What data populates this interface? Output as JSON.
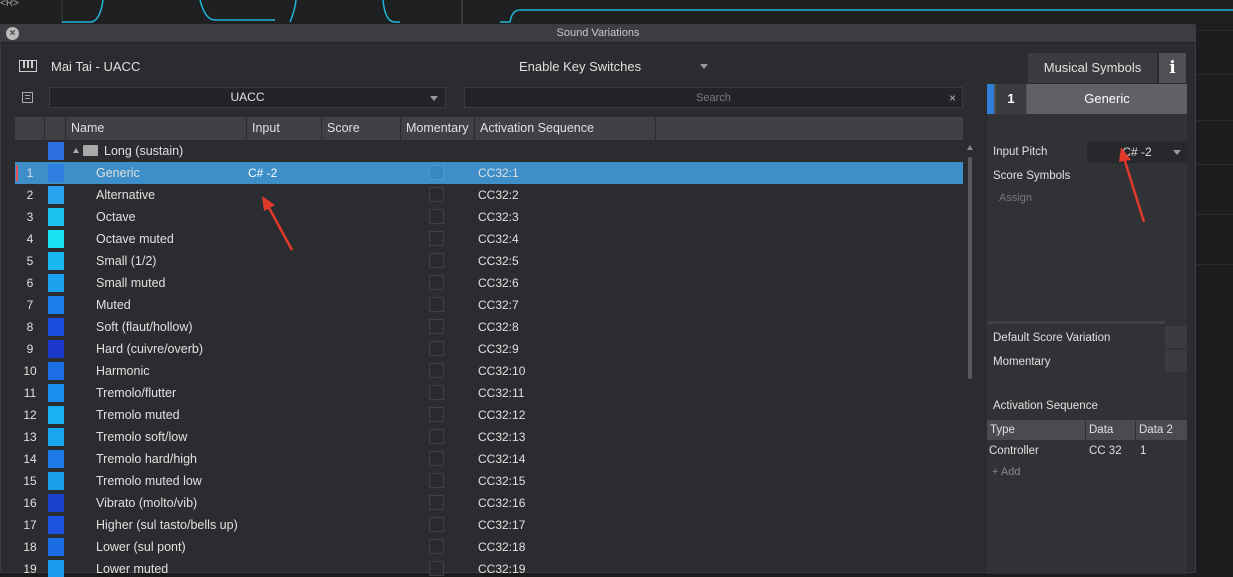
{
  "window": {
    "title": "Sound Variations"
  },
  "background": {
    "track_label": "<R>"
  },
  "header": {
    "instrument": "Mai Tai - UACC",
    "key_switch_mode": "Enable Key Switches",
    "tabs": {
      "musical_symbols": "Musical Symbols",
      "info": "i"
    }
  },
  "toolbar": {
    "preset": "UACC",
    "search_placeholder": "Search",
    "clear": "×"
  },
  "table": {
    "columns": [
      "Name",
      "Input",
      "Score",
      "Momentary",
      "Activation Sequence"
    ],
    "folder": "Long (sustain)",
    "rows": [
      {
        "num": "1",
        "name": "Generic",
        "input": "C# -2",
        "act": "CC32:1",
        "color": "#2f7fe0",
        "selected": true
      },
      {
        "num": "2",
        "name": "Alternative",
        "input": "",
        "act": "CC32:2",
        "color": "#2aa3ee"
      },
      {
        "num": "3",
        "name": "Octave",
        "input": "",
        "act": "CC32:3",
        "color": "#1cc3f0"
      },
      {
        "num": "4",
        "name": "Octave muted",
        "input": "",
        "act": "CC32:4",
        "color": "#19e5f2"
      },
      {
        "num": "5",
        "name": "Small (1/2)",
        "input": "",
        "act": "CC32:5",
        "color": "#1ab6f0"
      },
      {
        "num": "6",
        "name": "Small muted",
        "input": "",
        "act": "CC32:6",
        "color": "#1aa2ee"
      },
      {
        "num": "7",
        "name": "Muted",
        "input": "",
        "act": "CC32:7",
        "color": "#1b7fec"
      },
      {
        "num": "8",
        "name": "Soft (flaut/hollow)",
        "input": "",
        "act": "CC32:8",
        "color": "#1a4ddd"
      },
      {
        "num": "9",
        "name": "Hard (cuivre/overb)",
        "input": "",
        "act": "CC32:9",
        "color": "#1937c8"
      },
      {
        "num": "10",
        "name": "Harmonic",
        "input": "",
        "act": "CC32:10",
        "color": "#1c6ee4"
      },
      {
        "num": "11",
        "name": "Tremolo/flutter",
        "input": "",
        "act": "CC32:11",
        "color": "#1a8ff0"
      },
      {
        "num": "12",
        "name": "Tremolo muted",
        "input": "",
        "act": "CC32:12",
        "color": "#19b2f0"
      },
      {
        "num": "13",
        "name": "Tremolo soft/low",
        "input": "",
        "act": "CC32:13",
        "color": "#1aa6ee"
      },
      {
        "num": "14",
        "name": "Tremolo hard/high",
        "input": "",
        "act": "CC32:14",
        "color": "#1c7ae6"
      },
      {
        "num": "15",
        "name": "Tremolo muted low",
        "input": "",
        "act": "CC32:15",
        "color": "#1aa0ec"
      },
      {
        "num": "16",
        "name": "Vibrato (molto/vib)",
        "input": "",
        "act": "CC32:16",
        "color": "#1840c8"
      },
      {
        "num": "17",
        "name": "Higher (sul tasto/bells up)",
        "input": "",
        "act": "CC32:17",
        "color": "#1b52e0"
      },
      {
        "num": "18",
        "name": "Lower (sul pont)",
        "input": "",
        "act": "CC32:18",
        "color": "#1b6de6"
      },
      {
        "num": "19",
        "name": "Lower muted",
        "input": "",
        "act": "CC32:19",
        "color": "#1a99ee"
      }
    ]
  },
  "panel": {
    "num": "1",
    "name": "Generic",
    "input_pitch_label": "Input Pitch",
    "input_pitch": "C# -2",
    "score_symbols_label": "Score Symbols",
    "assign": "Assign",
    "default_score_variation": "Default Score Variation",
    "momentary": "Momentary",
    "activation_sequence": "Activation Sequence",
    "act_columns": [
      "Type",
      "Data",
      "Data 2"
    ],
    "act_row": {
      "type": "Controller",
      "data": "CC 32",
      "data2": "1"
    },
    "add": "+ Add"
  },
  "colors": {
    "selection": "#3d8ec9",
    "accent": "#2f7fd8",
    "annotation_arrow": "#e0392b"
  }
}
